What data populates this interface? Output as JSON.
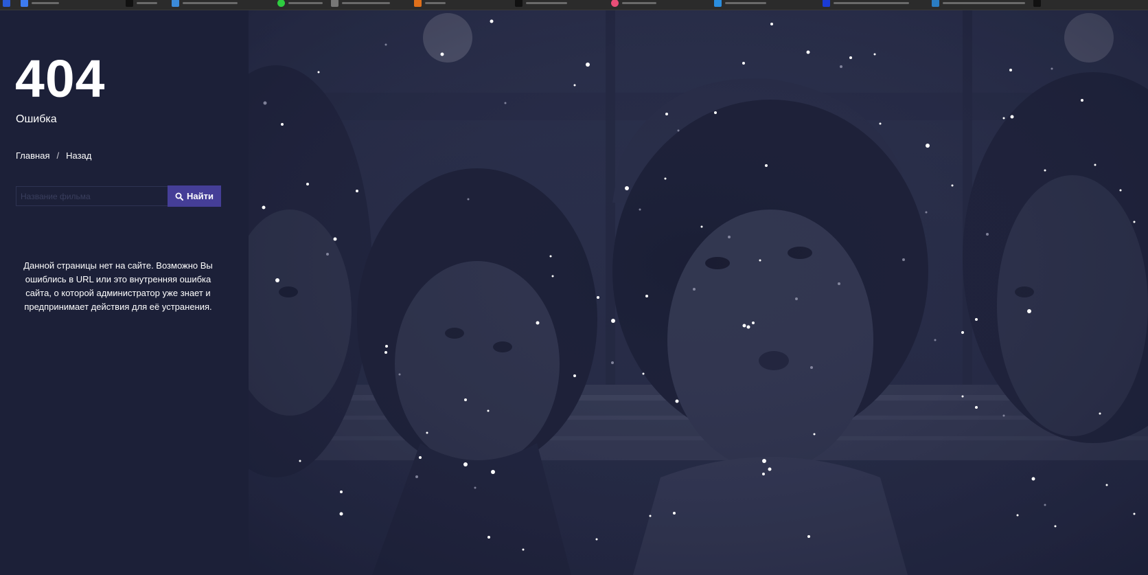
{
  "page": {
    "error_code": "404",
    "error_label": "Ошибка",
    "breadcrumb": {
      "home": "Главная",
      "separator": "/",
      "back": "Назад"
    },
    "search": {
      "placeholder": "Название фильма",
      "button_label": "Найти"
    },
    "message": "Данной страницы нет на сайте. Возможно Вы ошиблись в URL или это внутренняя ошибка сайта, о которой администратор уже знает и предпринимает действия для её устранения."
  },
  "colors": {
    "sidebar_bg": "#1c2038",
    "accent": "#453e97",
    "text": "#ffffff"
  },
  "icons": {
    "search_button": "search-icon",
    "hero_overlay": "snow-particles"
  }
}
